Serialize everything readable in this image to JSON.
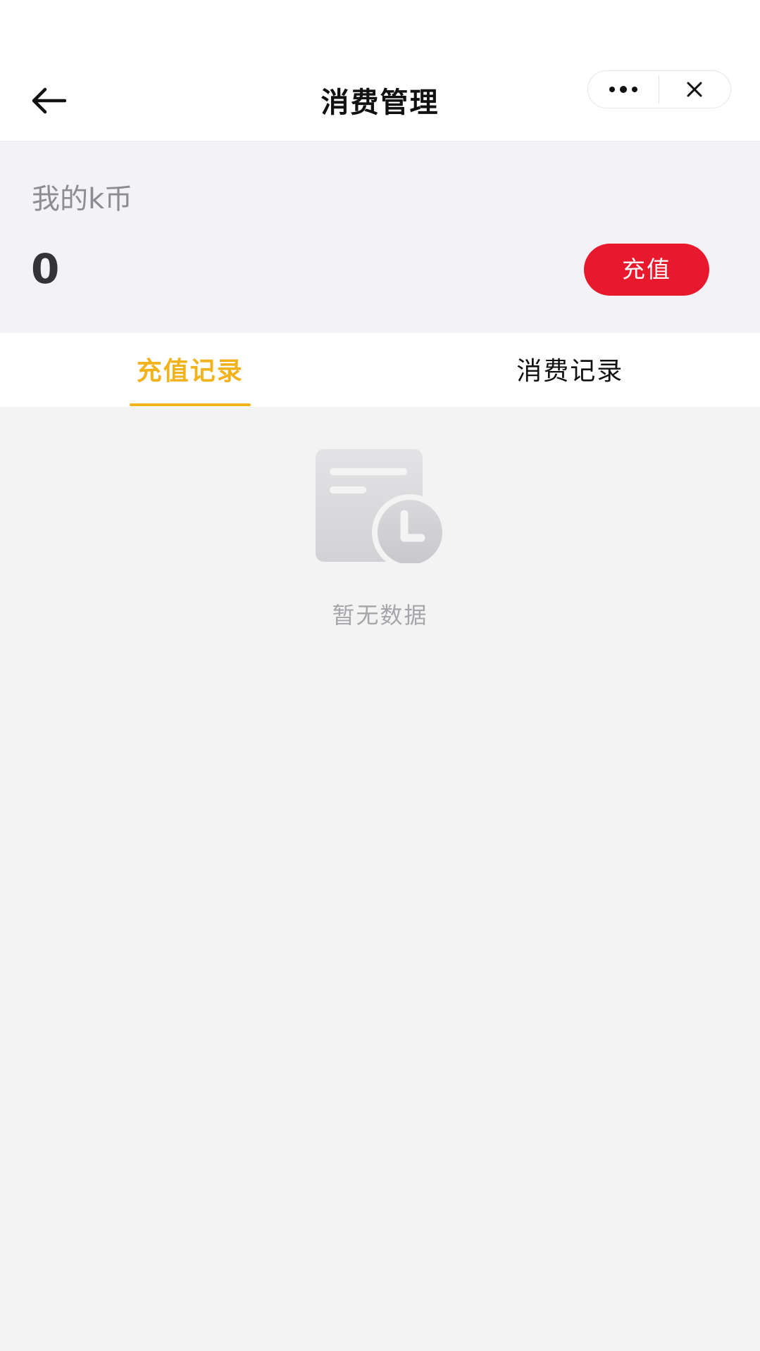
{
  "navbar": {
    "title": "消费管理",
    "back_icon": "arrow-left-icon",
    "more_icon": "more-dots-icon",
    "close_icon": "close-icon"
  },
  "balance": {
    "label": "我的k币",
    "value": "0",
    "recharge_label": "充值"
  },
  "tabs": [
    {
      "label": "充值记录",
      "active": true
    },
    {
      "label": "消费记录",
      "active": false
    }
  ],
  "empty_state": {
    "icon": "empty-document-clock-icon",
    "text": "暂无数据"
  },
  "colors": {
    "accent": "#f2b21b",
    "recharge_button": "#e8192c",
    "page_background": "#f3f3f4"
  }
}
